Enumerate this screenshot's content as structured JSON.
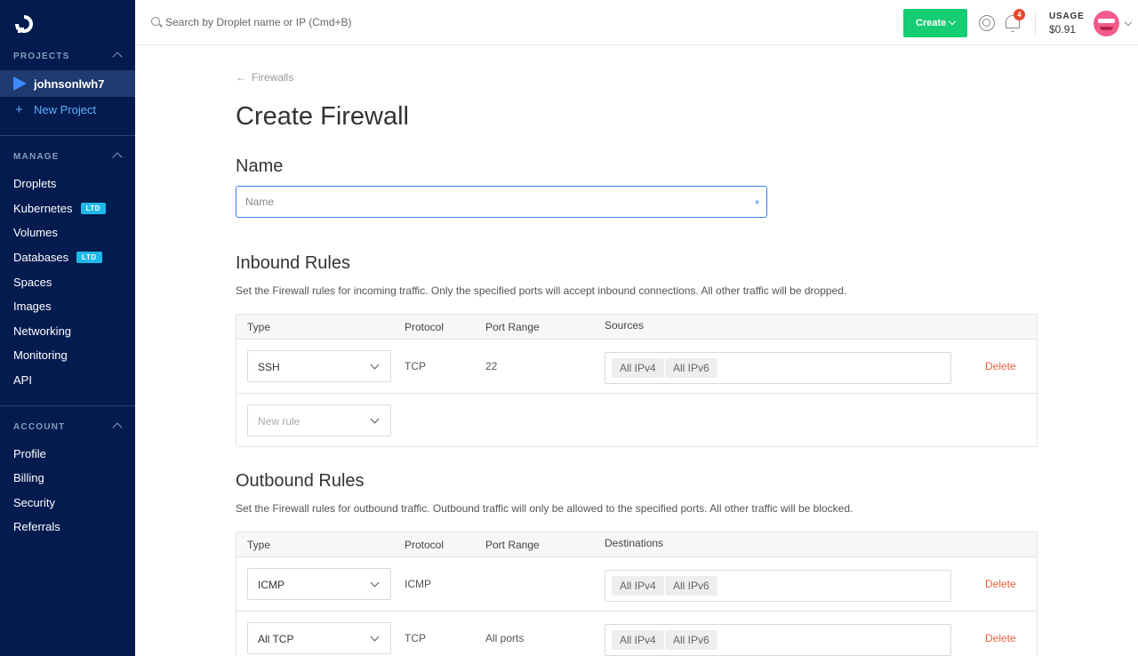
{
  "sidebar": {
    "projects_heading": "PROJECTS",
    "active_project": "johnsonlwh7",
    "new_project": "New Project",
    "manage_heading": "MANAGE",
    "manage_items": [
      {
        "label": "Droplets",
        "badge": ""
      },
      {
        "label": "Kubernetes",
        "badge": "LTD"
      },
      {
        "label": "Volumes",
        "badge": ""
      },
      {
        "label": "Databases",
        "badge": "LTD"
      },
      {
        "label": "Spaces",
        "badge": ""
      },
      {
        "label": "Images",
        "badge": ""
      },
      {
        "label": "Networking",
        "badge": ""
      },
      {
        "label": "Monitoring",
        "badge": ""
      },
      {
        "label": "API",
        "badge": ""
      }
    ],
    "account_heading": "ACCOUNT",
    "account_items": [
      {
        "label": "Profile"
      },
      {
        "label": "Billing"
      },
      {
        "label": "Security"
      },
      {
        "label": "Referrals"
      }
    ]
  },
  "topbar": {
    "search_placeholder": "Search by Droplet name or IP (Cmd+B)",
    "create_label": "Create",
    "notification_count": "4",
    "usage_label": "USAGE",
    "usage_value": "$0.91"
  },
  "main": {
    "back_label": "Firewalls",
    "title": "Create Firewall",
    "name_section": "Name",
    "name_placeholder": "Name",
    "inbound": {
      "title": "Inbound Rules",
      "description": "Set the Firewall rules for incoming traffic. Only the specified ports will accept inbound connections. All other traffic will be dropped.",
      "headers": {
        "type": "Type",
        "protocol": "Protocol",
        "port_range": "Port Range",
        "sources": "Sources"
      },
      "rows": [
        {
          "type": "SSH",
          "protocol": "TCP",
          "port_range": "22",
          "tags": [
            "All IPv4",
            "All IPv6"
          ],
          "delete": "Delete"
        }
      ],
      "new_rule_placeholder": "New rule"
    },
    "outbound": {
      "title": "Outbound Rules",
      "description": "Set the Firewall rules for outbound traffic. Outbound traffic will only be allowed to the specified ports. All other traffic will be blocked.",
      "headers": {
        "type": "Type",
        "protocol": "Protocol",
        "port_range": "Port Range",
        "destinations": "Destinations"
      },
      "rows": [
        {
          "type": "ICMP",
          "protocol": "ICMP",
          "port_range": "",
          "tags": [
            "All IPv4",
            "All IPv6"
          ],
          "delete": "Delete"
        },
        {
          "type": "All TCP",
          "protocol": "TCP",
          "port_range": "All ports",
          "tags": [
            "All IPv4",
            "All IPv6"
          ],
          "delete": "Delete"
        }
      ]
    }
  },
  "colors": {
    "sidebar_bg": "#031b4e",
    "accent_green": "#15cd72",
    "link_blue": "#3b7ee8",
    "delete_red": "#e8613c",
    "badge_blue": "#20b8e9"
  }
}
